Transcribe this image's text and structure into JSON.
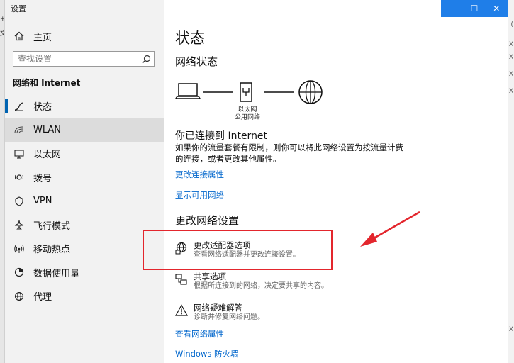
{
  "background": {
    "left_chars": [
      "+",
      "文"
    ],
    "right_chars": [
      "(",
      "X",
      "X",
      "X",
      "X",
      "X"
    ]
  },
  "window": {
    "title": "设置",
    "controls": {
      "minimize": "—",
      "maximize": "☐",
      "close": "✕"
    }
  },
  "sidebar": {
    "home_label": "主页",
    "search_placeholder": "查找设置",
    "section_title": "网络和 Internet",
    "items": [
      {
        "label": "状态",
        "icon": "status-icon",
        "active": true
      },
      {
        "label": "WLAN",
        "icon": "wifi-icon"
      },
      {
        "label": "以太网",
        "icon": "ethernet-icon"
      },
      {
        "label": "拨号",
        "icon": "dialup-icon"
      },
      {
        "label": "VPN",
        "icon": "vpn-icon"
      },
      {
        "label": "飞行模式",
        "icon": "airplane-icon"
      },
      {
        "label": "移动热点",
        "icon": "hotspot-icon"
      },
      {
        "label": "数据使用量",
        "icon": "data-usage-icon"
      },
      {
        "label": "代理",
        "icon": "proxy-icon"
      }
    ]
  },
  "main": {
    "page_title": "状态",
    "network_status_heading": "网络状态",
    "diagram_caption_line1": "以太网",
    "diagram_caption_line2": "公用网络",
    "connected_title": "你已连接到 Internet",
    "connected_desc": "如果你的流量套餐有限制，则你可以将此网络设置为按流量计费的连接，或者更改其他属性。",
    "link_change_props": "更改连接属性",
    "link_show_networks": "显示可用网络",
    "change_settings_heading": "更改网络设置",
    "options": [
      {
        "title": "更改适配器选项",
        "desc": "查看网络适配器并更改连接设置。",
        "icon": "adapter-icon"
      },
      {
        "title": "共享选项",
        "desc": "根据所连接到的网络，决定要共享的内容。",
        "icon": "sharing-icon"
      },
      {
        "title": "网络疑难解答",
        "desc": "诊断并修复网络问题。",
        "icon": "warning-icon"
      }
    ],
    "link_view_props": "查看网络属性",
    "link_firewall": "Windows 防火墙"
  },
  "colors": {
    "accent": "#0063b1",
    "link": "#0066cc",
    "annotation": "#e3262d",
    "titlebar": "#1f7ee8"
  }
}
